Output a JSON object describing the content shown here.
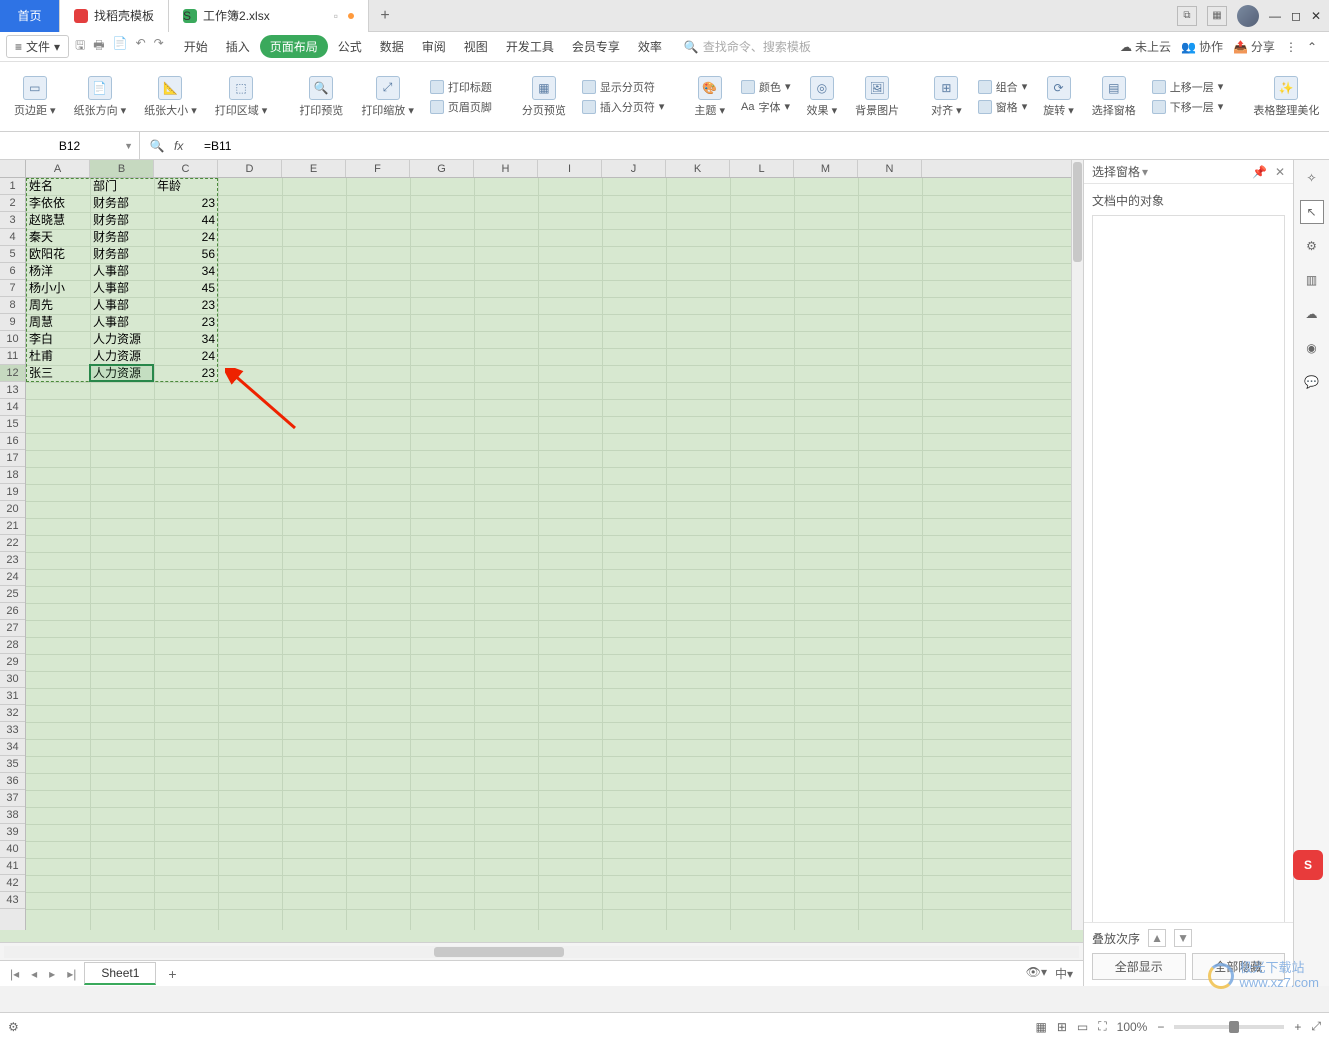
{
  "tabs": {
    "home": "首页",
    "template": "找稻壳模板",
    "file": "工作簿2.xlsx"
  },
  "menu": {
    "file": "文件",
    "items": [
      "开始",
      "插入",
      "页面布局",
      "公式",
      "数据",
      "审阅",
      "视图",
      "开发工具",
      "会员专享",
      "效率"
    ],
    "active_index": 2,
    "search_placeholder": "查找命令、搜索模板",
    "right": {
      "cloud": "未上云",
      "collab": "协作",
      "share": "分享"
    }
  },
  "ribbon": {
    "g1": [
      "页边距",
      "纸张方向",
      "纸张大小",
      "打印区域"
    ],
    "g2": [
      "打印预览",
      "打印缩放"
    ],
    "g3a": "打印标题",
    "g3b": "页眉页脚",
    "g4": [
      "分页预览"
    ],
    "g4a": "显示分页符",
    "g4b": "插入分页符",
    "g5": [
      "主题"
    ],
    "g5a": "颜色",
    "g5b": "字体",
    "g6": [
      "效果",
      "背景图片"
    ],
    "g7": [
      "对齐",
      "旋转"
    ],
    "g7a": "组合",
    "g7b": "窗格",
    "g8": [
      "选择窗格"
    ],
    "g8a": "上移一层",
    "g8b": "下移一层",
    "g9": [
      "表格整理美化"
    ]
  },
  "namebox": "B12",
  "formula": "=B11",
  "columns": [
    "A",
    "B",
    "C",
    "D",
    "E",
    "F",
    "G",
    "H",
    "I",
    "J",
    "K",
    "L",
    "M",
    "N"
  ],
  "sel": {
    "col_index": 1,
    "row_index": 11
  },
  "row_count": 43,
  "table": {
    "headers": [
      "姓名",
      "部门",
      "年龄"
    ],
    "rows": [
      [
        "李依依",
        "财务部",
        "23"
      ],
      [
        "赵晓慧",
        "财务部",
        "44"
      ],
      [
        "秦天",
        "财务部",
        "24"
      ],
      [
        "欧阳花",
        "财务部",
        "56"
      ],
      [
        "杨洋",
        "人事部",
        "34"
      ],
      [
        "杨小小",
        "人事部",
        "45"
      ],
      [
        "周先",
        "人事部",
        "23"
      ],
      [
        "周慧",
        "人事部",
        "23"
      ],
      [
        "李白",
        "人力资源部",
        "34"
      ],
      [
        "杜甫",
        "人力资源部",
        "24"
      ],
      [
        "张三",
        "人力资源部",
        "23"
      ]
    ]
  },
  "sheet_tab": "Sheet1",
  "right_panel": {
    "title": "选择窗格",
    "body_label": "文档中的对象",
    "order_label": "叠放次序",
    "btn_show": "全部显示",
    "btn_hide": "全部隐藏"
  },
  "status": {
    "zoom": "100%"
  },
  "ime": "S",
  "watermark": "极光下载站\nwww.xz7.com"
}
